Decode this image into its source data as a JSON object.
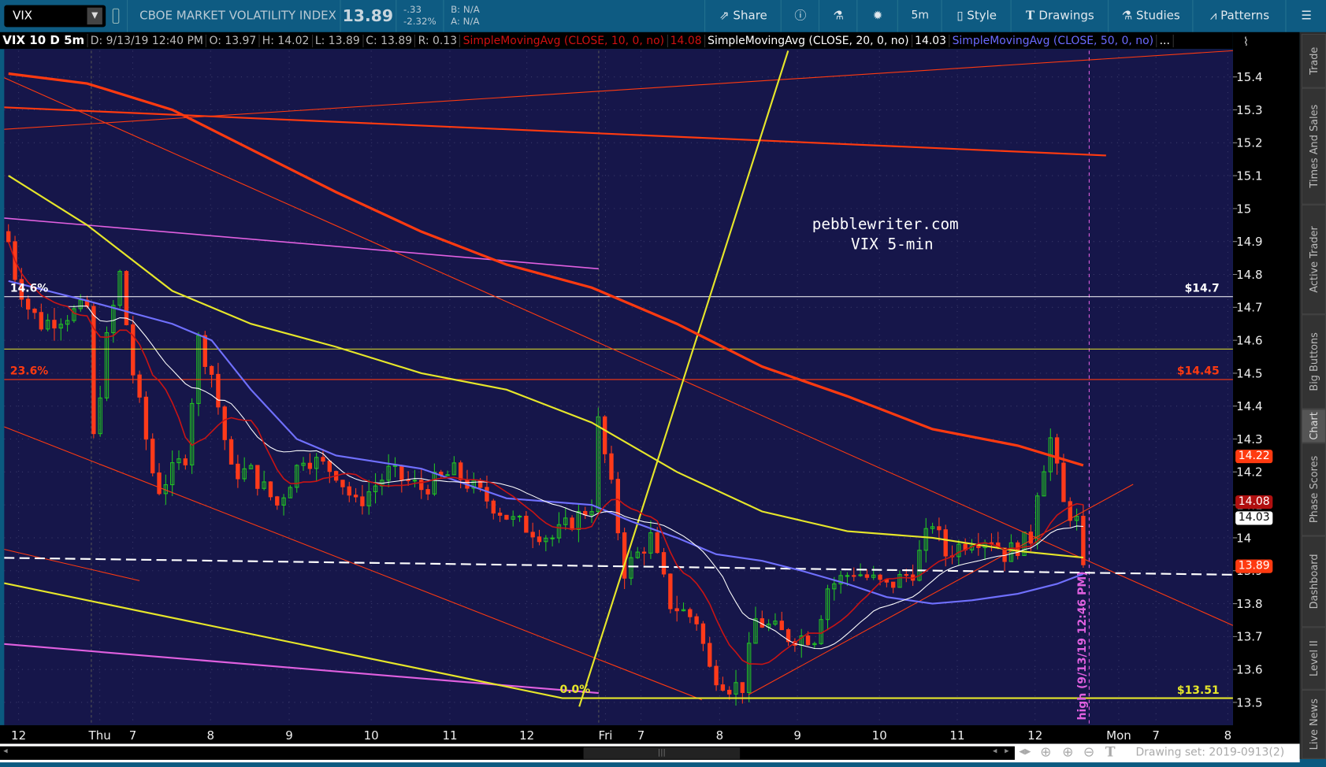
{
  "toolbar": {
    "symbol": "VIX",
    "description": "CBOE MARKET VOLATILITY INDEX",
    "last": "13.89",
    "change": "-.33",
    "change_pct": "-2.32%",
    "bid": "B: N/A",
    "ask": "A: N/A",
    "share": "Share",
    "timeframe": "5m",
    "style": "Style",
    "drawings": "Drawings",
    "studies": "Studies",
    "patterns": "Patterns"
  },
  "infobar": {
    "title": "VIX 10 D 5m",
    "date": "D: 9/13/19 12:40 PM",
    "open": "O: 13.97",
    "high": "H: 14.02",
    "low": "L: 13.89",
    "close": "C: 13.89",
    "range": "R: 0.13",
    "sma10": "SimpleMovingAvg (CLOSE, 10, 0, no)",
    "sma10_val": "14.08",
    "sma20": "SimpleMovingAvg (CLOSE, 20, 0, no)",
    "sma20_val": "14.03",
    "sma50": "SimpleMovingAvg (CLOSE, 50, 0, no)",
    "more": "..."
  },
  "sidebar": [
    "Trade",
    "Times And Sales",
    "Active Trader",
    "Big Buttons",
    "Chart",
    "Phase Scores",
    "Dashboard",
    "Level II",
    "Live News"
  ],
  "annotations": {
    "watermark1": "pebblewriter.com",
    "watermark2": "VIX 5-min",
    "fib_146": "14.6%",
    "fib_236": "23.6%",
    "fib_0": "0.0%",
    "level_147": "$14.7",
    "level_1445": "$14.45",
    "level_1351": "$13.51",
    "high_note": "high (9/13/19 12:46 PM)"
  },
  "price_tags": {
    "sma200": "14.22",
    "sma10": "14.08",
    "sma20": "14.03",
    "last": "13.89"
  },
  "bottom": {
    "drawing_set": "Drawing set: 2019-0913(2)"
  },
  "colors": {
    "bg": "#16164a",
    "up": "#22c422",
    "down": "#ff3a1a",
    "sma10": "#c81414",
    "sma20": "#ffffff",
    "sma50": "#7070ff",
    "sma100": "#e6e62a",
    "sma200": "#ff3a10"
  },
  "chart_data": {
    "type": "candlestick",
    "ylim": [
      13.46,
      15.48
    ],
    "y_ticks": [
      "15.4",
      "15.3",
      "15.2",
      "15.1",
      "15",
      "14.9",
      "14.8",
      "14.7",
      "14.6",
      "14.5",
      "14.4",
      "14.3",
      "14.2",
      "14.1",
      "14",
      "13.9",
      "13.8",
      "13.7",
      "13.6",
      "13.5"
    ],
    "x_ticks": [
      "12",
      "Thu",
      "7",
      "8",
      "9",
      "10",
      "11",
      "12",
      "Fri",
      "7",
      "8",
      "9",
      "10",
      "11",
      "12",
      "Mon",
      "7",
      "8"
    ],
    "close_path": [
      [
        0,
        14.9
      ],
      [
        1,
        14.8
      ],
      [
        3,
        14.7
      ],
      [
        5,
        14.65
      ],
      [
        12,
        14.7
      ],
      [
        13,
        14.3
      ],
      [
        15,
        14.6
      ],
      [
        17,
        14.8
      ],
      [
        19,
        14.5
      ],
      [
        22,
        14.2
      ],
      [
        23,
        14.15
      ],
      [
        27,
        14.25
      ],
      [
        29,
        14.6
      ],
      [
        31,
        14.5
      ],
      [
        34,
        14.2
      ],
      [
        37,
        14.2
      ],
      [
        41,
        14.1
      ],
      [
        45,
        14.25
      ],
      [
        50,
        14.2
      ],
      [
        53,
        14.1
      ],
      [
        58,
        14.2
      ],
      [
        63,
        14.15
      ],
      [
        68,
        14.2
      ],
      [
        74,
        14.1
      ],
      [
        77,
        14.05
      ],
      [
        83,
        14.0
      ],
      [
        86,
        14.05
      ],
      [
        89,
        14.1
      ],
      [
        90,
        14.35
      ],
      [
        92,
        14.15
      ],
      [
        94,
        13.9
      ],
      [
        98,
        14.0
      ],
      [
        101,
        13.8
      ],
      [
        105,
        13.75
      ],
      [
        107,
        13.6
      ],
      [
        110,
        13.55
      ],
      [
        112,
        13.55
      ],
      [
        114,
        13.75
      ],
      [
        119,
        13.7
      ],
      [
        123,
        13.7
      ],
      [
        125,
        13.85
      ],
      [
        129,
        13.9
      ],
      [
        134,
        13.85
      ],
      [
        138,
        13.9
      ],
      [
        141,
        14.05
      ],
      [
        143,
        13.95
      ],
      [
        147,
        14.0
      ],
      [
        150,
        14.0
      ],
      [
        152,
        13.95
      ],
      [
        156,
        14.0
      ],
      [
        157,
        14.15
      ],
      [
        159,
        14.3
      ],
      [
        161,
        14.1
      ],
      [
        163,
        14.05
      ],
      [
        164,
        13.89
      ]
    ],
    "sma50_path": [
      [
        0,
        14.78
      ],
      [
        12,
        14.72
      ],
      [
        25,
        14.65
      ],
      [
        31,
        14.6
      ],
      [
        37,
        14.45
      ],
      [
        44,
        14.3
      ],
      [
        50,
        14.25
      ],
      [
        63,
        14.21
      ],
      [
        76,
        14.12
      ],
      [
        89,
        14.1
      ],
      [
        95,
        14.05
      ],
      [
        102,
        14.0
      ],
      [
        108,
        13.95
      ],
      [
        115,
        13.93
      ],
      [
        121,
        13.9
      ],
      [
        128,
        13.86
      ],
      [
        134,
        13.82
      ],
      [
        141,
        13.8
      ],
      [
        147,
        13.81
      ],
      [
        154,
        13.83
      ],
      [
        160,
        13.86
      ],
      [
        164,
        13.89
      ]
    ],
    "sma100_path": [
      [
        0,
        15.1
      ],
      [
        12,
        14.95
      ],
      [
        25,
        14.75
      ],
      [
        37,
        14.65
      ],
      [
        50,
        14.58
      ],
      [
        63,
        14.5
      ],
      [
        76,
        14.45
      ],
      [
        89,
        14.35
      ],
      [
        102,
        14.2
      ],
      [
        115,
        14.08
      ],
      [
        128,
        14.02
      ],
      [
        141,
        14.0
      ],
      [
        154,
        13.96
      ],
      [
        164,
        13.94
      ]
    ],
    "sma200_path": [
      [
        0,
        15.41
      ],
      [
        12,
        15.38
      ],
      [
        25,
        15.3
      ],
      [
        37,
        15.18
      ],
      [
        50,
        15.05
      ],
      [
        63,
        14.93
      ],
      [
        76,
        14.83
      ],
      [
        89,
        14.76
      ],
      [
        102,
        14.65
      ],
      [
        115,
        14.52
      ],
      [
        128,
        14.43
      ],
      [
        141,
        14.33
      ],
      [
        154,
        14.28
      ],
      [
        164,
        14.22
      ]
    ]
  }
}
